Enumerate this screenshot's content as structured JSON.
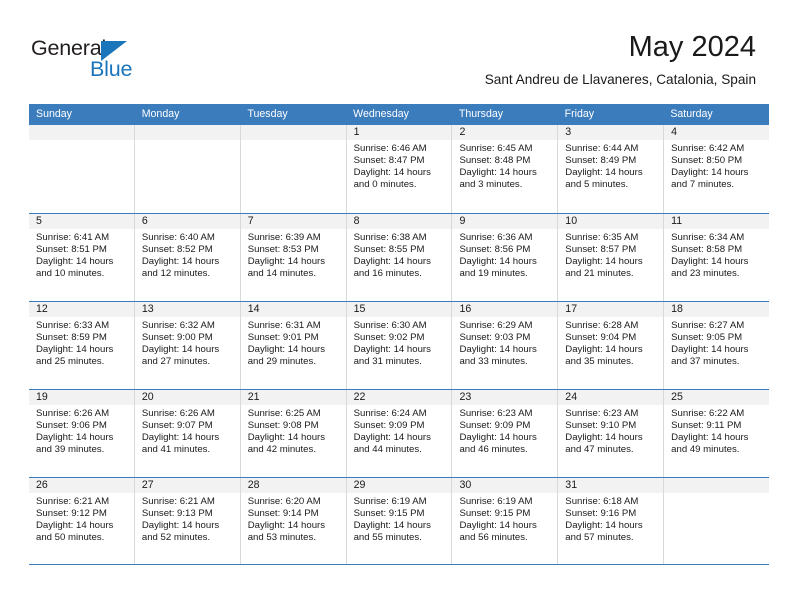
{
  "brand": {
    "name_part1": "General",
    "name_part2": "Blue",
    "accent_color": "#1b75bb",
    "triangle_icon": "triangle-icon"
  },
  "header": {
    "month_title": "May 2024",
    "location": "Sant Andreu de Llavaneres, Catalonia, Spain"
  },
  "calendar": {
    "header_color": "#3b7cbd",
    "weekdays": [
      "Sunday",
      "Monday",
      "Tuesday",
      "Wednesday",
      "Thursday",
      "Friday",
      "Saturday"
    ],
    "weeks": [
      [
        {
          "day": "",
          "sunrise": "",
          "sunset": "",
          "daylight": "",
          "daylight2": "",
          "empty": true
        },
        {
          "day": "",
          "sunrise": "",
          "sunset": "",
          "daylight": "",
          "daylight2": "",
          "empty": true
        },
        {
          "day": "",
          "sunrise": "",
          "sunset": "",
          "daylight": "",
          "daylight2": "",
          "empty": true
        },
        {
          "day": "1",
          "sunrise": "Sunrise: 6:46 AM",
          "sunset": "Sunset: 8:47 PM",
          "daylight": "Daylight: 14 hours",
          "daylight2": "and 0 minutes.",
          "empty": false
        },
        {
          "day": "2",
          "sunrise": "Sunrise: 6:45 AM",
          "sunset": "Sunset: 8:48 PM",
          "daylight": "Daylight: 14 hours",
          "daylight2": "and 3 minutes.",
          "empty": false
        },
        {
          "day": "3",
          "sunrise": "Sunrise: 6:44 AM",
          "sunset": "Sunset: 8:49 PM",
          "daylight": "Daylight: 14 hours",
          "daylight2": "and 5 minutes.",
          "empty": false
        },
        {
          "day": "4",
          "sunrise": "Sunrise: 6:42 AM",
          "sunset": "Sunset: 8:50 PM",
          "daylight": "Daylight: 14 hours",
          "daylight2": "and 7 minutes.",
          "empty": false
        }
      ],
      [
        {
          "day": "5",
          "sunrise": "Sunrise: 6:41 AM",
          "sunset": "Sunset: 8:51 PM",
          "daylight": "Daylight: 14 hours",
          "daylight2": "and 10 minutes.",
          "empty": false
        },
        {
          "day": "6",
          "sunrise": "Sunrise: 6:40 AM",
          "sunset": "Sunset: 8:52 PM",
          "daylight": "Daylight: 14 hours",
          "daylight2": "and 12 minutes.",
          "empty": false
        },
        {
          "day": "7",
          "sunrise": "Sunrise: 6:39 AM",
          "sunset": "Sunset: 8:53 PM",
          "daylight": "Daylight: 14 hours",
          "daylight2": "and 14 minutes.",
          "empty": false
        },
        {
          "day": "8",
          "sunrise": "Sunrise: 6:38 AM",
          "sunset": "Sunset: 8:55 PM",
          "daylight": "Daylight: 14 hours",
          "daylight2": "and 16 minutes.",
          "empty": false
        },
        {
          "day": "9",
          "sunrise": "Sunrise: 6:36 AM",
          "sunset": "Sunset: 8:56 PM",
          "daylight": "Daylight: 14 hours",
          "daylight2": "and 19 minutes.",
          "empty": false
        },
        {
          "day": "10",
          "sunrise": "Sunrise: 6:35 AM",
          "sunset": "Sunset: 8:57 PM",
          "daylight": "Daylight: 14 hours",
          "daylight2": "and 21 minutes.",
          "empty": false
        },
        {
          "day": "11",
          "sunrise": "Sunrise: 6:34 AM",
          "sunset": "Sunset: 8:58 PM",
          "daylight": "Daylight: 14 hours",
          "daylight2": "and 23 minutes.",
          "empty": false
        }
      ],
      [
        {
          "day": "12",
          "sunrise": "Sunrise: 6:33 AM",
          "sunset": "Sunset: 8:59 PM",
          "daylight": "Daylight: 14 hours",
          "daylight2": "and 25 minutes.",
          "empty": false
        },
        {
          "day": "13",
          "sunrise": "Sunrise: 6:32 AM",
          "sunset": "Sunset: 9:00 PM",
          "daylight": "Daylight: 14 hours",
          "daylight2": "and 27 minutes.",
          "empty": false
        },
        {
          "day": "14",
          "sunrise": "Sunrise: 6:31 AM",
          "sunset": "Sunset: 9:01 PM",
          "daylight": "Daylight: 14 hours",
          "daylight2": "and 29 minutes.",
          "empty": false
        },
        {
          "day": "15",
          "sunrise": "Sunrise: 6:30 AM",
          "sunset": "Sunset: 9:02 PM",
          "daylight": "Daylight: 14 hours",
          "daylight2": "and 31 minutes.",
          "empty": false
        },
        {
          "day": "16",
          "sunrise": "Sunrise: 6:29 AM",
          "sunset": "Sunset: 9:03 PM",
          "daylight": "Daylight: 14 hours",
          "daylight2": "and 33 minutes.",
          "empty": false
        },
        {
          "day": "17",
          "sunrise": "Sunrise: 6:28 AM",
          "sunset": "Sunset: 9:04 PM",
          "daylight": "Daylight: 14 hours",
          "daylight2": "and 35 minutes.",
          "empty": false
        },
        {
          "day": "18",
          "sunrise": "Sunrise: 6:27 AM",
          "sunset": "Sunset: 9:05 PM",
          "daylight": "Daylight: 14 hours",
          "daylight2": "and 37 minutes.",
          "empty": false
        }
      ],
      [
        {
          "day": "19",
          "sunrise": "Sunrise: 6:26 AM",
          "sunset": "Sunset: 9:06 PM",
          "daylight": "Daylight: 14 hours",
          "daylight2": "and 39 minutes.",
          "empty": false
        },
        {
          "day": "20",
          "sunrise": "Sunrise: 6:26 AM",
          "sunset": "Sunset: 9:07 PM",
          "daylight": "Daylight: 14 hours",
          "daylight2": "and 41 minutes.",
          "empty": false
        },
        {
          "day": "21",
          "sunrise": "Sunrise: 6:25 AM",
          "sunset": "Sunset: 9:08 PM",
          "daylight": "Daylight: 14 hours",
          "daylight2": "and 42 minutes.",
          "empty": false
        },
        {
          "day": "22",
          "sunrise": "Sunrise: 6:24 AM",
          "sunset": "Sunset: 9:09 PM",
          "daylight": "Daylight: 14 hours",
          "daylight2": "and 44 minutes.",
          "empty": false
        },
        {
          "day": "23",
          "sunrise": "Sunrise: 6:23 AM",
          "sunset": "Sunset: 9:09 PM",
          "daylight": "Daylight: 14 hours",
          "daylight2": "and 46 minutes.",
          "empty": false
        },
        {
          "day": "24",
          "sunrise": "Sunrise: 6:23 AM",
          "sunset": "Sunset: 9:10 PM",
          "daylight": "Daylight: 14 hours",
          "daylight2": "and 47 minutes.",
          "empty": false
        },
        {
          "day": "25",
          "sunrise": "Sunrise: 6:22 AM",
          "sunset": "Sunset: 9:11 PM",
          "daylight": "Daylight: 14 hours",
          "daylight2": "and 49 minutes.",
          "empty": false
        }
      ],
      [
        {
          "day": "26",
          "sunrise": "Sunrise: 6:21 AM",
          "sunset": "Sunset: 9:12 PM",
          "daylight": "Daylight: 14 hours",
          "daylight2": "and 50 minutes.",
          "empty": false
        },
        {
          "day": "27",
          "sunrise": "Sunrise: 6:21 AM",
          "sunset": "Sunset: 9:13 PM",
          "daylight": "Daylight: 14 hours",
          "daylight2": "and 52 minutes.",
          "empty": false
        },
        {
          "day": "28",
          "sunrise": "Sunrise: 6:20 AM",
          "sunset": "Sunset: 9:14 PM",
          "daylight": "Daylight: 14 hours",
          "daylight2": "and 53 minutes.",
          "empty": false
        },
        {
          "day": "29",
          "sunrise": "Sunrise: 6:19 AM",
          "sunset": "Sunset: 9:15 PM",
          "daylight": "Daylight: 14 hours",
          "daylight2": "and 55 minutes.",
          "empty": false
        },
        {
          "day": "30",
          "sunrise": "Sunrise: 6:19 AM",
          "sunset": "Sunset: 9:15 PM",
          "daylight": "Daylight: 14 hours",
          "daylight2": "and 56 minutes.",
          "empty": false
        },
        {
          "day": "31",
          "sunrise": "Sunrise: 6:18 AM",
          "sunset": "Sunset: 9:16 PM",
          "daylight": "Daylight: 14 hours",
          "daylight2": "and 57 minutes.",
          "empty": false
        },
        {
          "day": "",
          "sunrise": "",
          "sunset": "",
          "daylight": "",
          "daylight2": "",
          "empty": true
        }
      ]
    ]
  }
}
